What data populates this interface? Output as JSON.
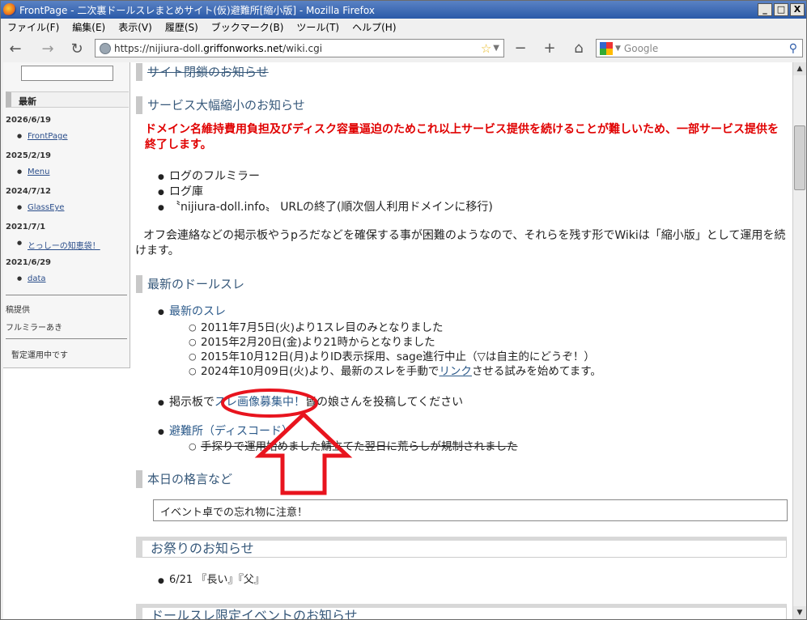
{
  "window": {
    "title": "FrontPage - 二次裏ドールスレまとめサイト(仮)避難所[縮小版] - Mozilla Firefox",
    "minimize": "_",
    "maximize": "□",
    "close": "X"
  },
  "menu": [
    "ファイル(F)",
    "編集(E)",
    "表示(V)",
    "履歴(S)",
    "ブックマーク(B)",
    "ツール(T)",
    "ヘルプ(H)"
  ],
  "nav": {
    "back": "←",
    "forward": "→",
    "reload": "↻",
    "url_prefix": "https://nijiura-doll.",
    "url_domain": "griffonworks.net",
    "url_path": "/wiki.cgi",
    "star": "☆",
    "zoom_out": "−",
    "zoom_in": "+",
    "home": "⌂",
    "search_placeholder": "Google",
    "search_glass": "⚲"
  },
  "sidebar": {
    "recent_label": "最新",
    "entries": [
      {
        "date": "2026/6/19",
        "link": "FrontPage"
      },
      {
        "date": "2025/2/19",
        "link": "Menu"
      },
      {
        "date": "2024/7/12",
        "link": "GlassEye"
      },
      {
        "date": "2021/7/1",
        "link": "とっしーの知恵袋！"
      },
      {
        "date": "2021/6/29",
        "link": "data"
      }
    ],
    "extra1": "稿提供",
    "extra2": "フルミラーあき",
    "extra3": "暫定運用中です"
  },
  "content": {
    "h_closed": "サイト閉鎖のお知らせ",
    "h_shrink": "サービス大幅縮小のお知らせ",
    "red_notice": "ドメイン名維持費用負担及びディスク容量逼迫のためこれ以上サービス提供を続けることが難しいため、一部サービス提供を終了します。",
    "ended": [
      "ログのフルミラー",
      "ログ庫",
      "〝nijiura-doll.info〟 URLの終了(順次個人利用ドメインに移行)"
    ],
    "para": "オフ会連絡などの掲示板やうpろだなどを確保する事が困難のようなので、それらを残す形でWikiは「縮小版」として運用を続けます。",
    "h_latest": "最新のドールスレ",
    "latest_link": "最新のスレ",
    "sub": [
      "2011年7月5日(火)より1スレ目のみとなりました",
      "2015年2月20日(金)より21時からとなりました",
      "2015年10月12日(月)よりID表示採用、sage進行中止（▽は自主的にどうぞ！）"
    ],
    "sub4_pre": "2024年10月09日(火)より、最新のスレを手動で",
    "sub4_link": "リンク",
    "sub4_post": "させる試みを始めてます。",
    "board_pre": "掲示板で",
    "board_link": "スレ画像募集中！",
    "board_post": "皆の娘さんを投稿してください",
    "shelter_link": "避難所（ディスコード）",
    "shelter_sub": "手探りで運用始めました鯖立てた翌日に荒らしが規制されました",
    "h_quote": "本日の格言など",
    "quote": "イベント卓での忘れ物に注意！",
    "h_festival": "お祭りのお知らせ",
    "festival_item": "6/21 『長い』『父』",
    "h_event": "ドールスレ限定イベントのお知らせ"
  },
  "colors": {
    "annotation": "#e8141e",
    "heading": "#36587a",
    "notice": "#e00000"
  }
}
